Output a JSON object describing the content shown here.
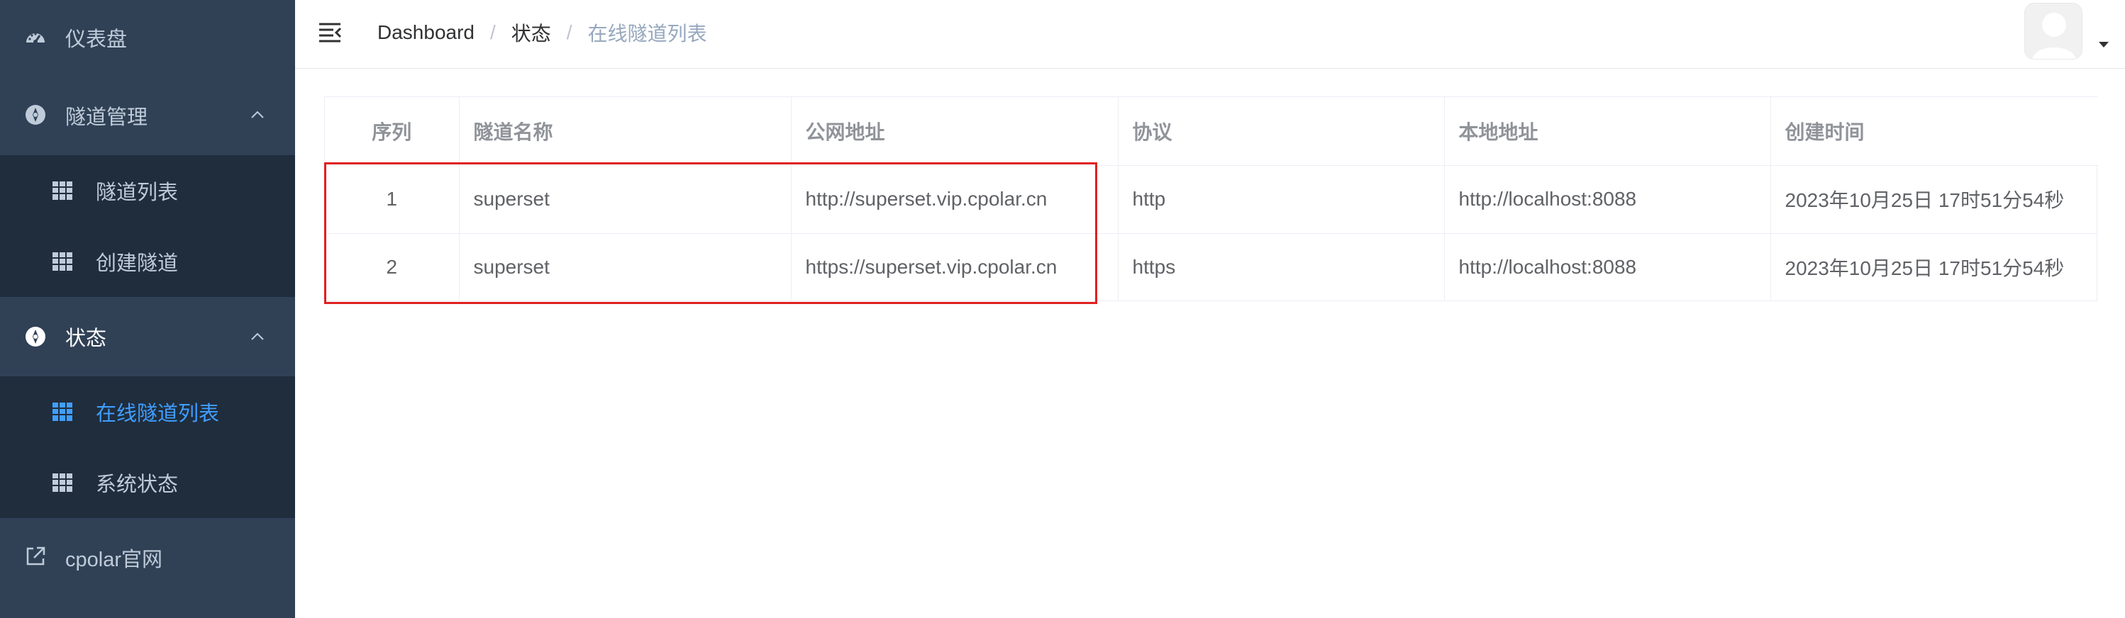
{
  "sidebar": {
    "dashboard": "仪表盘",
    "tunnel_management": "隧道管理",
    "tunnel_list": "隧道列表",
    "create_tunnel": "创建隧道",
    "status": "状态",
    "online_tunnel_list": "在线隧道列表",
    "system_status": "系统状态",
    "official_site": "cpolar官网"
  },
  "breadcrumb": {
    "home": "Dashboard",
    "separator": "/",
    "level1": "状态",
    "current": "在线隧道列表"
  },
  "table": {
    "columns": [
      "序列",
      "隧道名称",
      "公网地址",
      "协议",
      "本地地址",
      "创建时间"
    ],
    "rows": [
      [
        "1",
        "superset",
        "http://superset.vip.cpolar.cn",
        "http",
        "http://localhost:8088",
        "2023年10月25日 17时51分54秒"
      ],
      [
        "2",
        "superset",
        "https://superset.vip.cpolar.cn",
        "https",
        "http://localhost:8088",
        "2023年10月25日 17时51分54秒"
      ]
    ]
  },
  "colors": {
    "sidebar_bg": "#304156",
    "submenu_bg": "#1f2d3d",
    "active": "#409eff",
    "highlight": "#e02020"
  }
}
